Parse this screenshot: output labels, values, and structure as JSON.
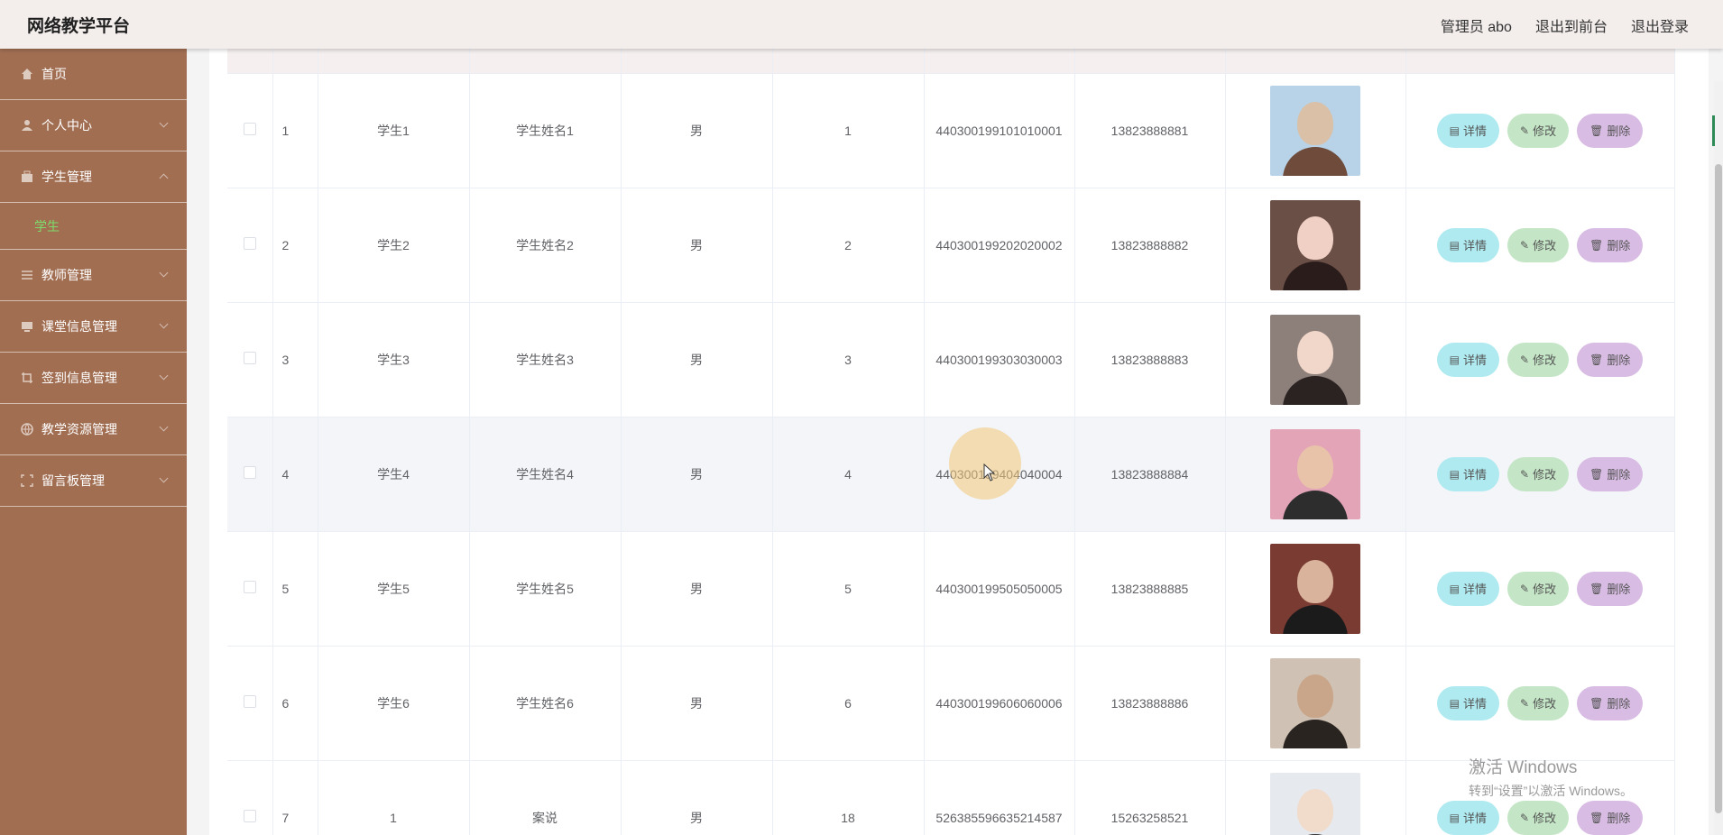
{
  "header": {
    "title": "网络教学平台",
    "admin_label": "管理员 abo",
    "front_label": "退出到前台",
    "logout_label": "退出登录"
  },
  "sidebar": {
    "items": [
      {
        "label": "首页",
        "icon": "home-icon"
      },
      {
        "label": "个人中心",
        "icon": "user-icon"
      },
      {
        "label": "学生管理",
        "icon": "briefcase-icon",
        "expanded": true,
        "sub": "学生"
      },
      {
        "label": "教师管理",
        "icon": "sliders-icon"
      },
      {
        "label": "课堂信息管理",
        "icon": "monitor-icon"
      },
      {
        "label": "签到信息管理",
        "icon": "crop-icon"
      },
      {
        "label": "教学资源管理",
        "icon": "globe-icon"
      },
      {
        "label": "留言板管理",
        "icon": "frame-icon"
      }
    ]
  },
  "table": {
    "actions": {
      "detail": "详情",
      "edit": "修改",
      "delete": "删除"
    },
    "rows": [
      {
        "index": "1",
        "xuehao": "学生1",
        "name": "学生姓名1",
        "gender": "男",
        "grade": "1",
        "idcard": "440300199101010001",
        "phone": "13823888881"
      },
      {
        "index": "2",
        "xuehao": "学生2",
        "name": "学生姓名2",
        "gender": "男",
        "grade": "2",
        "idcard": "440300199202020002",
        "phone": "13823888882"
      },
      {
        "index": "3",
        "xuehao": "学生3",
        "name": "学生姓名3",
        "gender": "男",
        "grade": "3",
        "idcard": "440300199303030003",
        "phone": "13823888883"
      },
      {
        "index": "4",
        "xuehao": "学生4",
        "name": "学生姓名4",
        "gender": "男",
        "grade": "4",
        "idcard": "440300199404040004",
        "phone": "13823888884"
      },
      {
        "index": "5",
        "xuehao": "学生5",
        "name": "学生姓名5",
        "gender": "男",
        "grade": "5",
        "idcard": "440300199505050005",
        "phone": "13823888885"
      },
      {
        "index": "6",
        "xuehao": "学生6",
        "name": "学生姓名6",
        "gender": "男",
        "grade": "6",
        "idcard": "440300199606060006",
        "phone": "13823888886"
      },
      {
        "index": "7",
        "xuehao": "1",
        "name": "案说",
        "gender": "男",
        "grade": "18",
        "idcard": "526385596635214587",
        "phone": "15263258521"
      }
    ]
  },
  "colors": {
    "sidebar_bg": "#a16e52",
    "active_sub": "#7ddc6b",
    "btn_detail": "#aeeaf0",
    "btn_edit": "#c4e6c6",
    "btn_delete": "#d8bce4"
  },
  "watermark": {
    "line1": "激活 Windows",
    "line2": "转到“设置”以激活 Windows。"
  }
}
